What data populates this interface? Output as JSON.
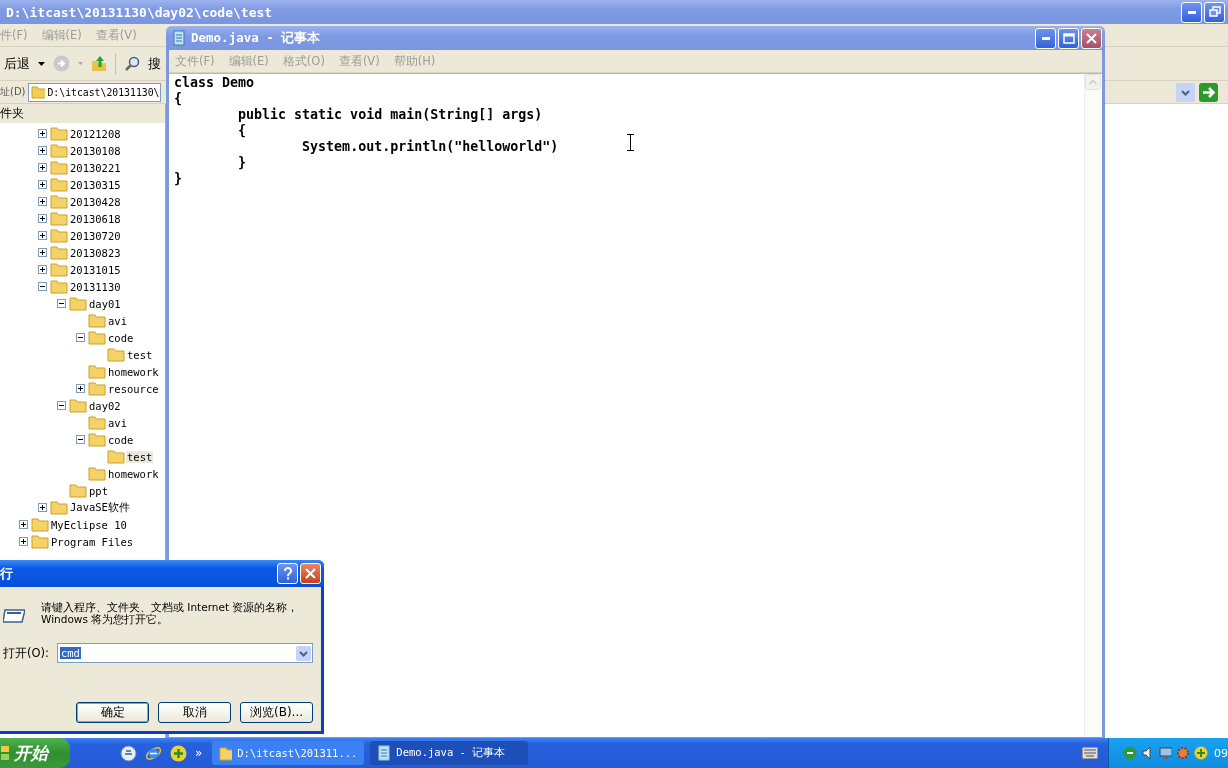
{
  "explorer": {
    "title": "D:\\itcast\\20131130\\day02\\code\\test",
    "menu": [
      "件(F)",
      "编辑(E)",
      "查看(V)"
    ],
    "toolbar": {
      "back": "后退",
      "search": "搜"
    },
    "address": {
      "label": "址(D)",
      "value": "D:\\itcast\\20131130\\"
    },
    "folders_pane": {
      "title": "件夹"
    },
    "tree": {
      "branch": [
        {
          "label": "20121208",
          "kind": "branch",
          "expanded": false,
          "selected": false
        },
        {
          "label": "20130108",
          "kind": "branch",
          "expanded": false,
          "selected": false
        },
        {
          "label": "20130221",
          "kind": "branch",
          "expanded": false,
          "selected": false
        },
        {
          "label": "20130315",
          "kind": "branch",
          "expanded": false,
          "selected": false
        },
        {
          "label": "20130428",
          "kind": "branch",
          "expanded": false,
          "selected": false
        },
        {
          "label": "20130618",
          "kind": "branch",
          "expanded": false,
          "selected": false
        },
        {
          "label": "20130720",
          "kind": "branch",
          "expanded": false,
          "selected": false
        },
        {
          "label": "20130823",
          "kind": "branch",
          "expanded": false,
          "selected": false
        },
        {
          "label": "20131015",
          "kind": "branch",
          "expanded": false,
          "selected": false
        },
        {
          "label": "20131130",
          "kind": "branch",
          "expanded": true,
          "selected": false,
          "children": [
            {
              "label": "day01",
              "kind": "branch",
              "expanded": true,
              "selected": false,
              "children": [
                {
                  "label": "avi",
                  "kind": "leaf",
                  "selected": false
                },
                {
                  "label": "code",
                  "kind": "branch",
                  "expanded": true,
                  "selected": false,
                  "children": [
                    {
                      "label": "test",
                      "kind": "leaf",
                      "selected": false
                    }
                  ]
                },
                {
                  "label": "homework",
                  "kind": "leaf",
                  "selected": false
                },
                {
                  "label": "resource",
                  "kind": "branch",
                  "expanded": false,
                  "selected": false
                }
              ]
            },
            {
              "label": "day02",
              "kind": "branch",
              "expanded": true,
              "selected": false,
              "children": [
                {
                  "label": "avi",
                  "kind": "leaf",
                  "selected": false
                },
                {
                  "label": "code",
                  "kind": "branch",
                  "expanded": true,
                  "selected": false,
                  "children": [
                    {
                      "label": "test",
                      "kind": "leaf",
                      "selected": true
                    }
                  ]
                },
                {
                  "label": "homework",
                  "kind": "leaf",
                  "selected": false
                }
              ]
            },
            {
              "label": "ppt",
              "kind": "leaf",
              "selected": false
            }
          ]
        },
        {
          "label": "JavaSE软件",
          "kind": "branch",
          "expanded": false,
          "selected": false
        }
      ],
      "items": [
        {
          "label": "MyEclipse 10",
          "kind": "branch",
          "expanded": false,
          "selected": false
        },
        {
          "label": "Program Files",
          "kind": "branch",
          "expanded": false,
          "selected": false
        }
      ]
    }
  },
  "notepad": {
    "title": "Demo.java - 记事本",
    "menu": [
      "文件(F)",
      "编辑(E)",
      "格式(O)",
      "查看(V)",
      "帮助(H)"
    ],
    "lines": [
      "class Demo",
      "{",
      "\tpublic static void main(String[] args)",
      "\t{",
      "\t\tSystem.out.println(\"helloworld\")",
      "\t}",
      "}"
    ]
  },
  "run_dialog": {
    "title": "行",
    "description": "请键入程序、文件夹、文档或 Internet 资源的名称，Windows 将为您打开它。",
    "open_label": "打开(O):",
    "open_value": "cmd",
    "value_highlighted": true,
    "buttons": [
      "确定",
      "取消",
      "浏览(B)..."
    ]
  },
  "taskbar": {
    "start": "开始",
    "more": "»",
    "tasks": [
      {
        "label": "D:\\itcast\\201311...",
        "kind": "folder",
        "selected": false
      },
      {
        "label": "Demo.java - 记事本",
        "kind": "notepad",
        "selected": true
      }
    ],
    "clock": "09"
  }
}
